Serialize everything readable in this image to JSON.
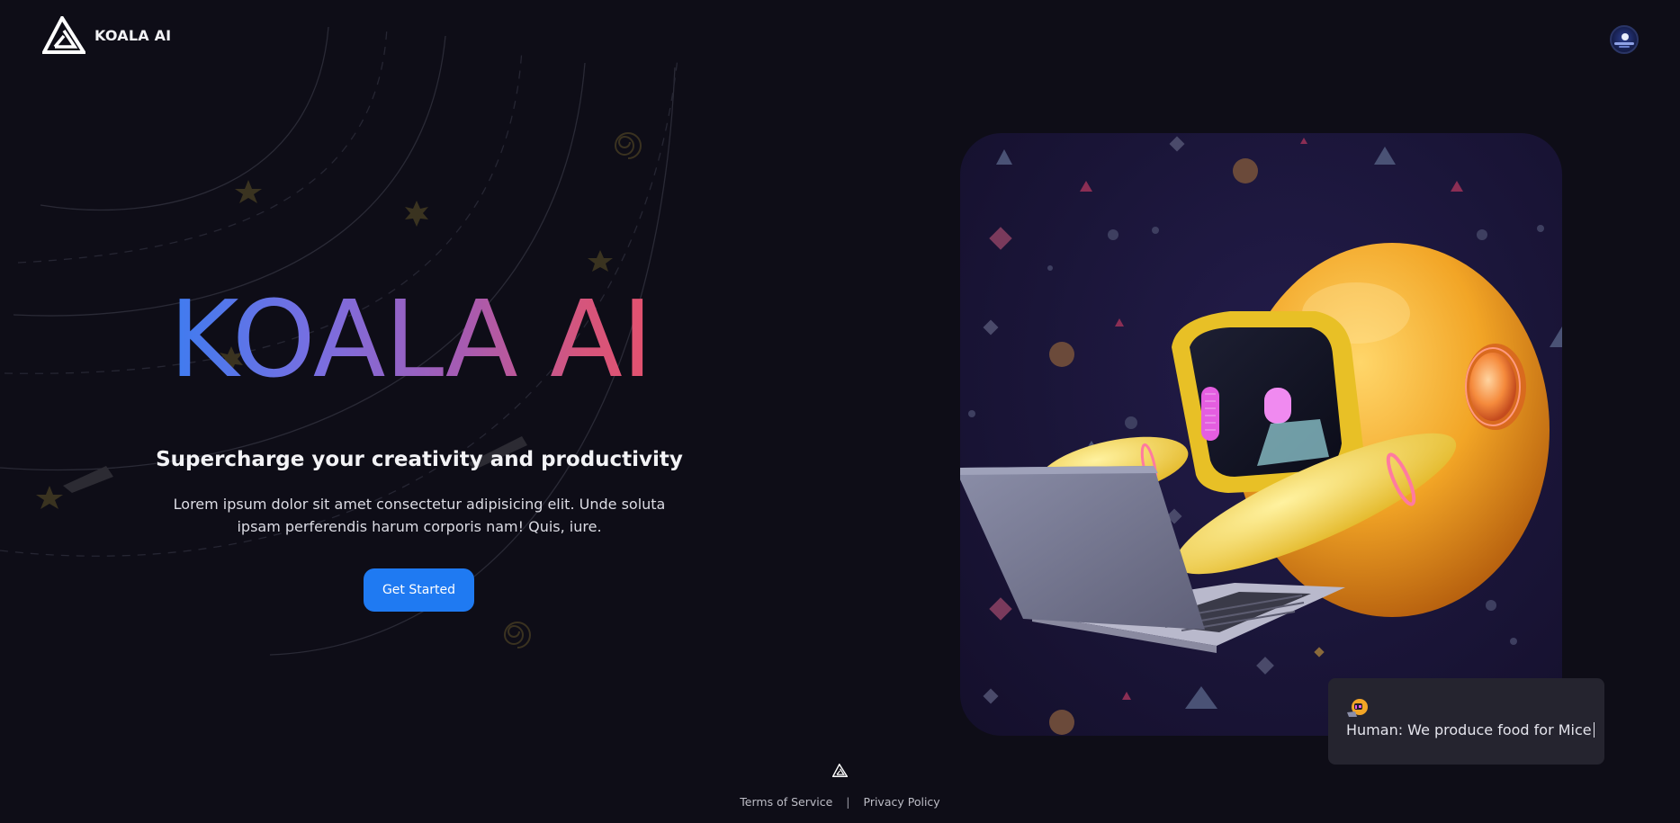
{
  "header": {
    "brand": "KOALA AI",
    "logo_icon": "koala-triangle-logo",
    "avatar_icon": "profile-avatar"
  },
  "hero": {
    "title": "KOALA AI",
    "subtitle": "Supercharge your creativity and productivity",
    "description": "Lorem ipsum dolor sit amet consectetur adipisicing elit. Unde soluta ipsam perferendis harum corporis nam! Quis, iure.",
    "cta_label": "Get Started"
  },
  "card": {
    "illustration": "robot-with-laptop",
    "background_color": "#1a1538"
  },
  "chat": {
    "icon": "robot-emoji",
    "text": "Human: We produce food for Mice"
  },
  "footer": {
    "logo_icon": "koala-triangle-logo",
    "links": [
      "Terms of Service",
      "Privacy Policy"
    ],
    "separator": "|"
  },
  "colors": {
    "background": "#0e0d17",
    "accent": "#1f7af2",
    "gradient": [
      "#3e7cf0",
      "#a65bb2",
      "#e8516a"
    ]
  }
}
